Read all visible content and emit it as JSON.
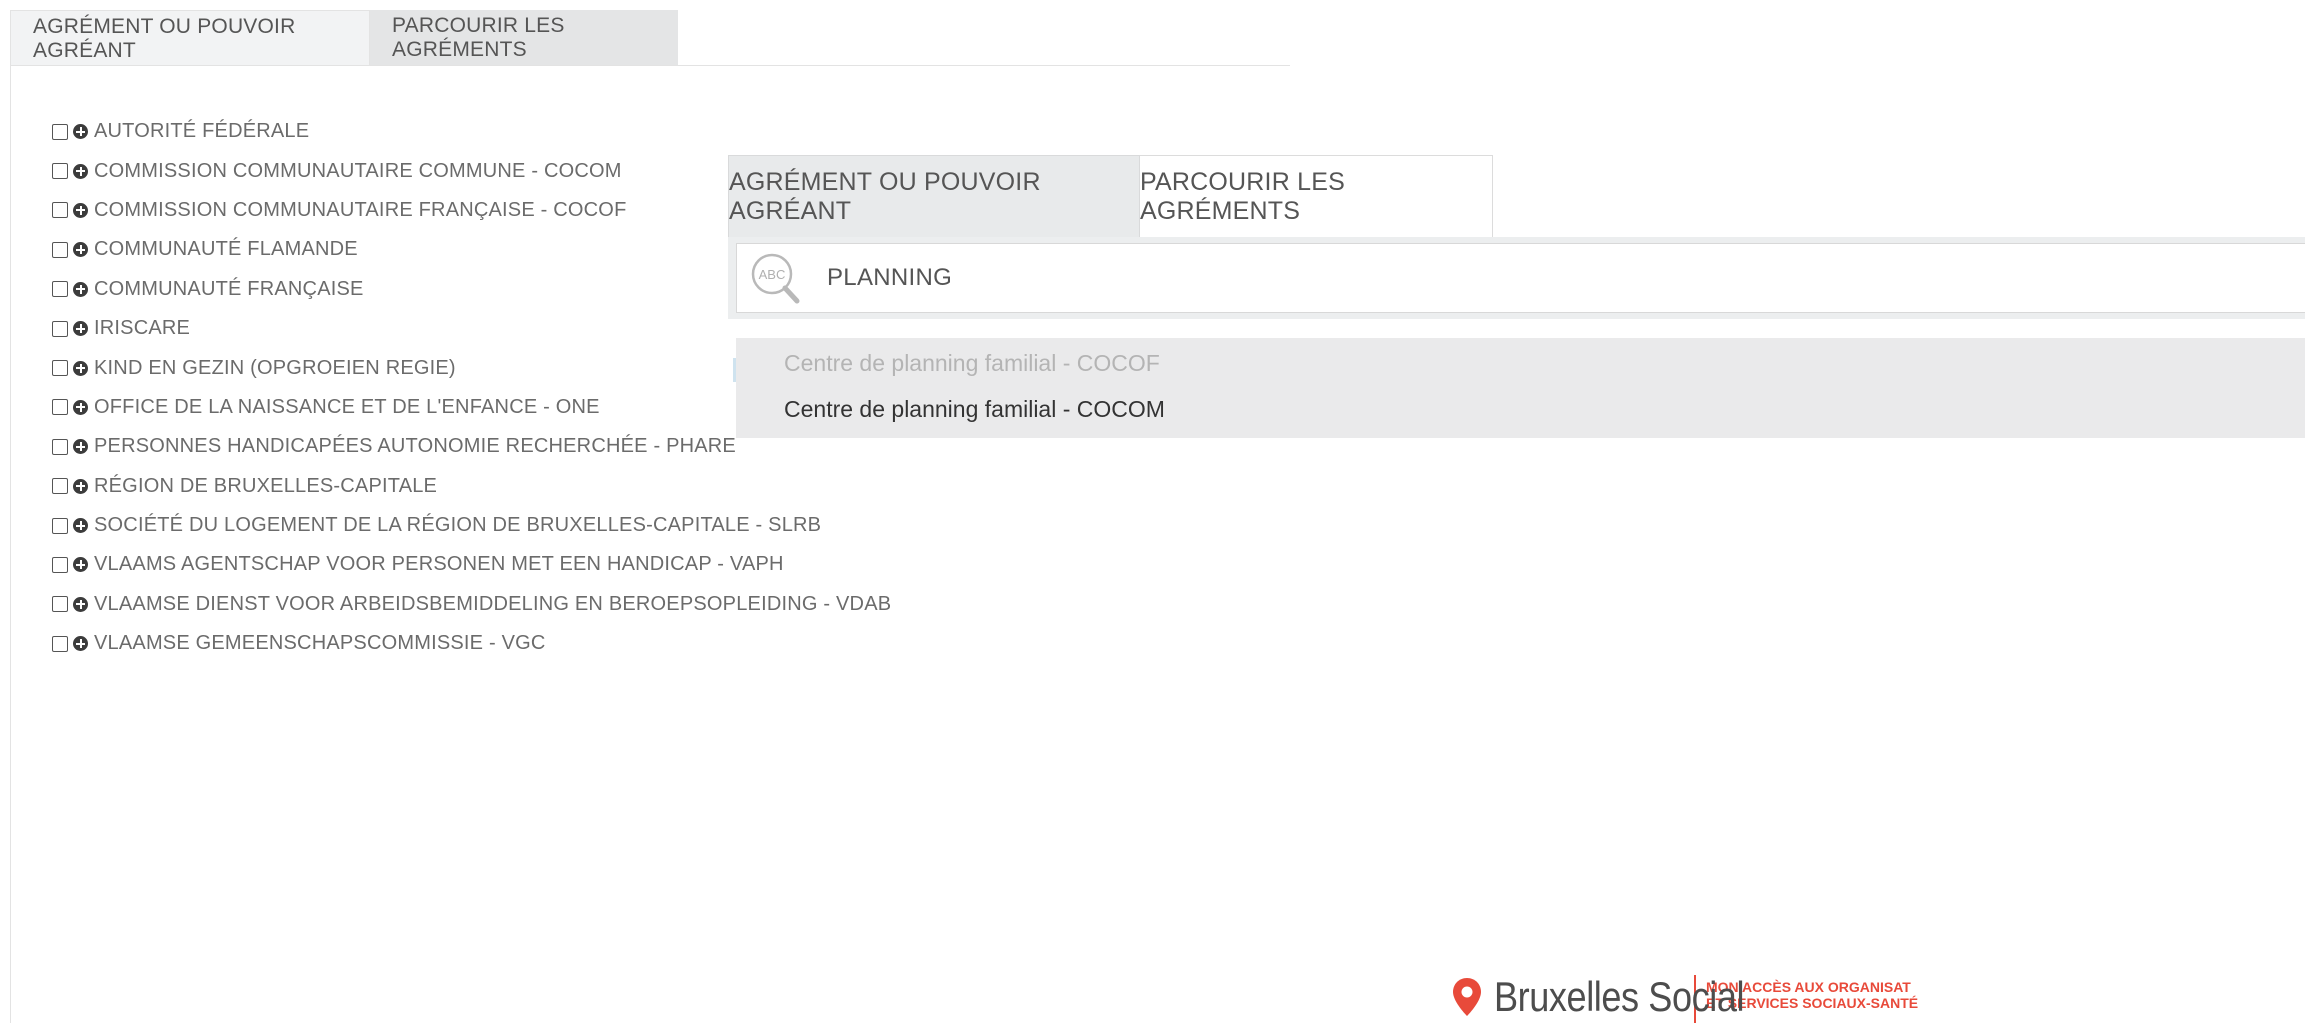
{
  "left_panel": {
    "tabs": [
      {
        "label": "AGRÉMENT OU POUVOIR AGRÉANT"
      },
      {
        "label": "PARCOURIR LES AGRÉMENTS"
      }
    ],
    "agencies": [
      "AUTORITÉ FÉDÉRALE",
      "COMMISSION COMMUNAUTAIRE COMMUNE - COCOM",
      "COMMISSION COMMUNAUTAIRE FRANÇAISE - COCOF",
      "COMMUNAUTÉ FLAMANDE",
      "COMMUNAUTÉ FRANÇAISE",
      "IRISCARE",
      "KIND EN GEZIN (OPGROEIEN REGIE)",
      "OFFICE DE LA NAISSANCE ET DE L'ENFANCE - ONE",
      "PERSONNES HANDICAPÉES AUTONOMIE RECHERCHÉE - PHARE",
      "RÉGION DE BRUXELLES-CAPITALE",
      "SOCIÉTÉ DU LOGEMENT DE LA RÉGION DE BRUXELLES-CAPITALE - SLRB",
      "VLAAMS AGENTSCHAP VOOR PERSONEN MET EEN HANDICAP - VAPH",
      "VLAAMSE DIENST VOOR ARBEIDSBEMIDDELING EN BEROEPSOPLEIDING - VDAB",
      "VLAAMSE GEMEENSCHAPSCOMMISSIE - VGC"
    ]
  },
  "right_panel": {
    "tabs": [
      {
        "label": "AGRÉMENT OU POUVOIR AGRÉANT"
      },
      {
        "label": "PARCOURIR LES AGRÉMENTS"
      }
    ],
    "search": {
      "value": "PLANNING",
      "icon": "abc-search-icon",
      "icon_text": "ABC"
    },
    "results": [
      "Centre de planning familial - COCOF",
      "Centre de planning familial - COCOM"
    ]
  },
  "logo": {
    "brand": "Bruxelles Social",
    "tagline_line1": "MON ACCÈS AUX ORGANISAT",
    "tagline_line2": "ET SERVICES SOCIAUX-SANTÉ",
    "color": "#e84a3a"
  }
}
